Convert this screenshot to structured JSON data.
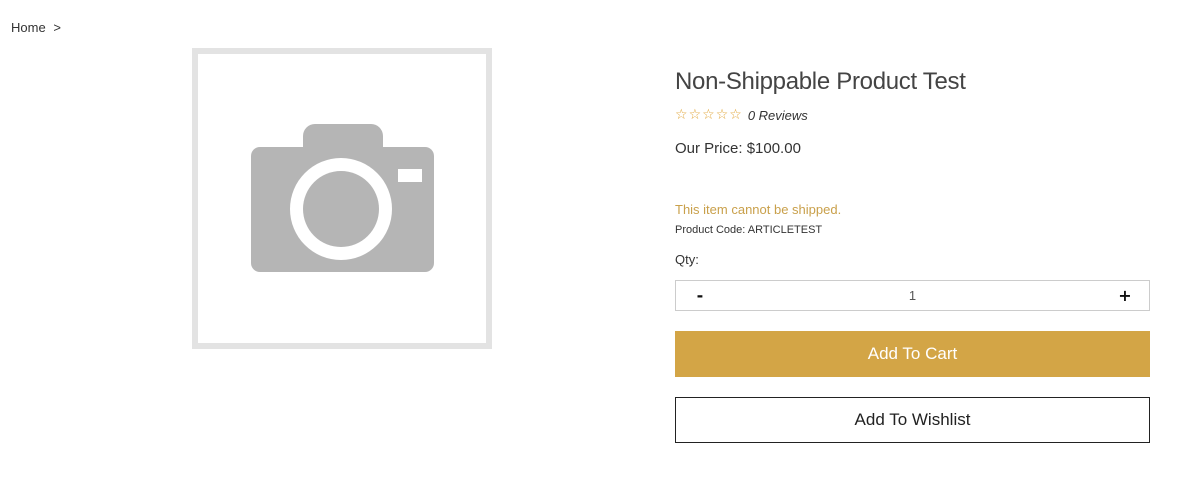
{
  "breadcrumb": {
    "home": "Home",
    "separator": ">"
  },
  "product": {
    "image_icon": "camera-placeholder-icon",
    "title": "Non-Shippable Product Test",
    "rating_stars": 0,
    "star_glyph": "☆",
    "reviews_text": "0 Reviews",
    "price_label": "Our Price:",
    "price_value": "$100.00",
    "shipping_note": "This item cannot be shipped.",
    "code_label": "Product Code:",
    "code_value": "ARTICLETEST"
  },
  "quantity": {
    "label": "Qty:",
    "minus": "-",
    "value": "1",
    "plus": "+"
  },
  "actions": {
    "add_to_cart": "Add To Cart",
    "add_to_wishlist": "Add To Wishlist"
  },
  "colors": {
    "accent": "#d3a546",
    "star": "#e1a63a",
    "shipping_note": "#c9a04b",
    "image_border": "#e3e3e3",
    "placeholder_icon": "#b5b5b5"
  }
}
